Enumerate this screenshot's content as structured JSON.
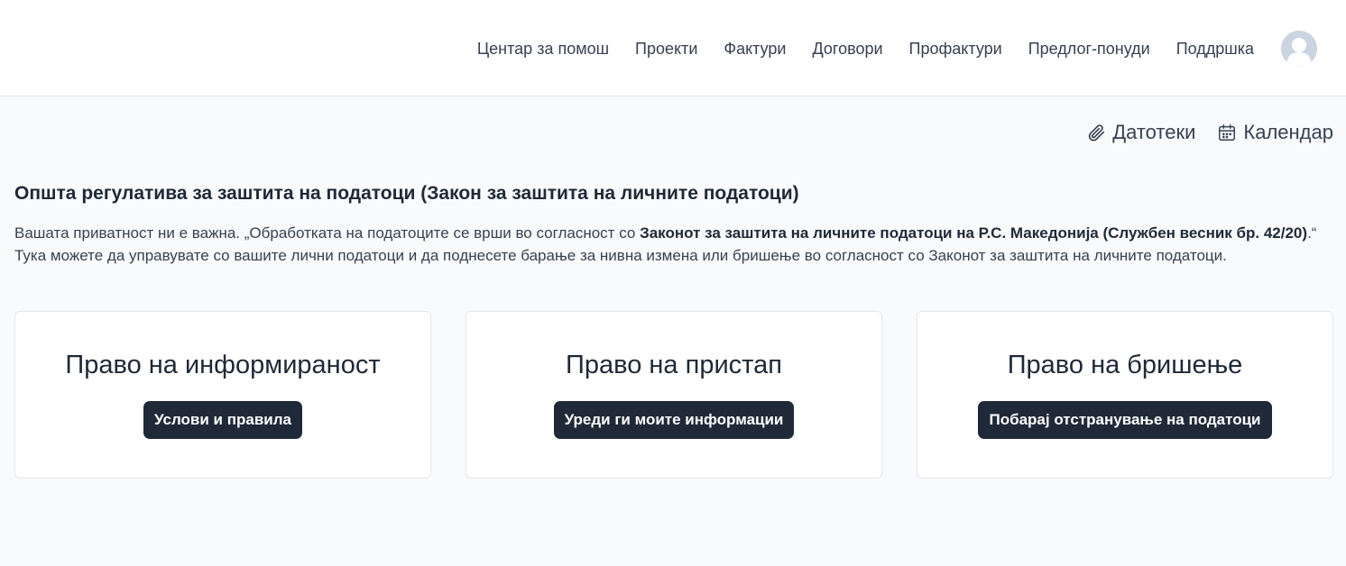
{
  "nav": {
    "items": [
      {
        "label": "Центар за помош"
      },
      {
        "label": "Проекти"
      },
      {
        "label": "Фактури"
      },
      {
        "label": "Договори"
      },
      {
        "label": "Профактури"
      },
      {
        "label": "Предлог-понуди"
      },
      {
        "label": "Поддршка"
      }
    ],
    "avatar_icon": "user-avatar-icon"
  },
  "toolbar": {
    "files_label": "Датотеки",
    "files_icon": "paperclip-icon",
    "calendar_label": "Календар",
    "calendar_icon": "calendar-icon"
  },
  "gdpr": {
    "title": "Општа регулатива за заштита на податоци (Закон за заштита на личните податоци)",
    "text_part1": "Вашата приватност ни е важна. „Обработката на податоците се врши во согласност со ",
    "text_bold": "Законот за заштита на личните податоци на Р.С. Македонија (Службен весник бр. 42/20)",
    "text_part2": ".“ Тука можете да управувате со вашите лични податоци и да поднесете барање за нивна измена или бришење во согласност со Законот за заштита на личните податоци."
  },
  "cards": [
    {
      "title": "Право на информираност",
      "button": "Услови и правила"
    },
    {
      "title": "Право на пристап",
      "button": "Уреди ги моите информации"
    },
    {
      "title": "Право на бришење",
      "button": "Побарај отстранување на податоци"
    }
  ],
  "colors": {
    "background": "#f8fafc",
    "button": "#1f2937",
    "avatar": "#cbd5e1"
  }
}
